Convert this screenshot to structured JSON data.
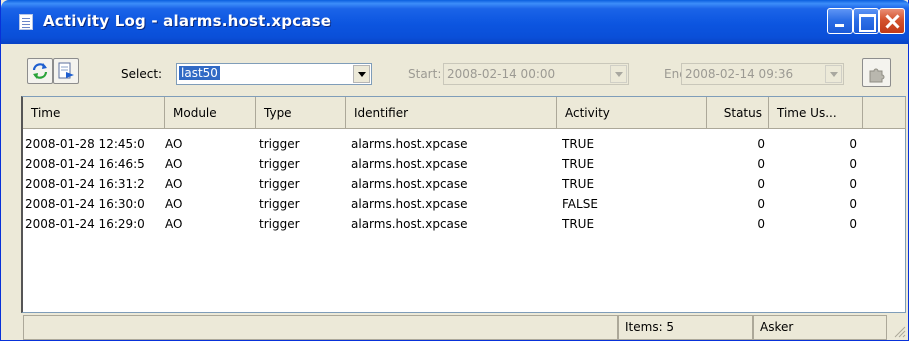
{
  "window": {
    "title": "Activity Log - alarms.host.xpcase"
  },
  "toolbar": {
    "select_label": "Select:",
    "select_value": "last50",
    "start_label": "Start:",
    "start_value": "2008-02-14 00:00",
    "end_label": "End:",
    "end_value": "2008-02-14 09:36"
  },
  "table": {
    "columns": [
      "Time",
      "Module",
      "Type",
      "Identifier",
      "Activity",
      "Status",
      "Time Us..."
    ],
    "rows": [
      [
        "2008-01-28 12:45:0",
        "AO",
        "trigger",
        "alarms.host.xpcase",
        "TRUE",
        "0",
        "0"
      ],
      [
        "2008-01-24 16:46:5",
        "AO",
        "trigger",
        "alarms.host.xpcase",
        "TRUE",
        "0",
        "0"
      ],
      [
        "2008-01-24 16:31:2",
        "AO",
        "trigger",
        "alarms.host.xpcase",
        "TRUE",
        "0",
        "0"
      ],
      [
        "2008-01-24 16:30:0",
        "AO",
        "trigger",
        "alarms.host.xpcase",
        "FALSE",
        "0",
        "0"
      ],
      [
        "2008-01-24 16:29:0",
        "AO",
        "trigger",
        "alarms.host.xpcase",
        "TRUE",
        "0",
        "0"
      ]
    ]
  },
  "statusbar": {
    "main_text": "",
    "items_text": "Items: 5",
    "user_text": "Asker"
  }
}
